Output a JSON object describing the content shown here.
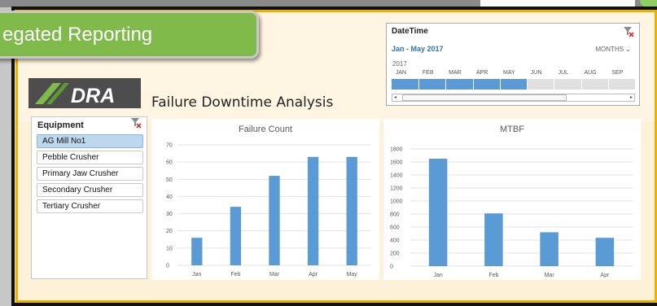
{
  "banner": {
    "title": "egated Reporting"
  },
  "logo": {
    "text": "DRA"
  },
  "page": {
    "title": "Failure Downtime Analysis"
  },
  "equipment_slicer": {
    "header": "Equipment",
    "items": [
      {
        "label": "AG Mill No1",
        "selected": true
      },
      {
        "label": "Pebble Crusher",
        "selected": false
      },
      {
        "label": "Primary Jaw Crusher",
        "selected": false
      },
      {
        "label": "Secondary Crusher",
        "selected": false
      },
      {
        "label": "Tertiary Crusher",
        "selected": false
      }
    ]
  },
  "timeline": {
    "title": "DateTime",
    "range": "Jan - May 2017",
    "level": "MONTHS",
    "year": "2017",
    "months": [
      "JAN",
      "FEB",
      "MAR",
      "APR",
      "MAY",
      "JUN",
      "JUL",
      "AUG",
      "SEP"
    ],
    "selected_count": 5,
    "accent": "#5b9bd5"
  },
  "chart_data": [
    {
      "type": "bar",
      "title": "Failure Count",
      "categories": [
        "Jan",
        "Feb",
        "Mar",
        "Apr",
        "May"
      ],
      "values": [
        16,
        34,
        52,
        63,
        63
      ],
      "ylim": [
        0,
        70
      ],
      "yticks": [
        0,
        10,
        20,
        30,
        40,
        50,
        60,
        70
      ],
      "grid": true,
      "color": "#5b9bd5"
    },
    {
      "type": "bar",
      "title": "MTBF",
      "categories": [
        "Jan",
        "Feb",
        "Mar",
        "Apr"
      ],
      "values": [
        1650,
        810,
        520,
        435
      ],
      "ylim": [
        0,
        1800
      ],
      "yticks": [
        0,
        200,
        400,
        600,
        800,
        1000,
        1200,
        1400,
        1600,
        1800
      ],
      "grid": true,
      "color": "#5b9bd5"
    }
  ]
}
